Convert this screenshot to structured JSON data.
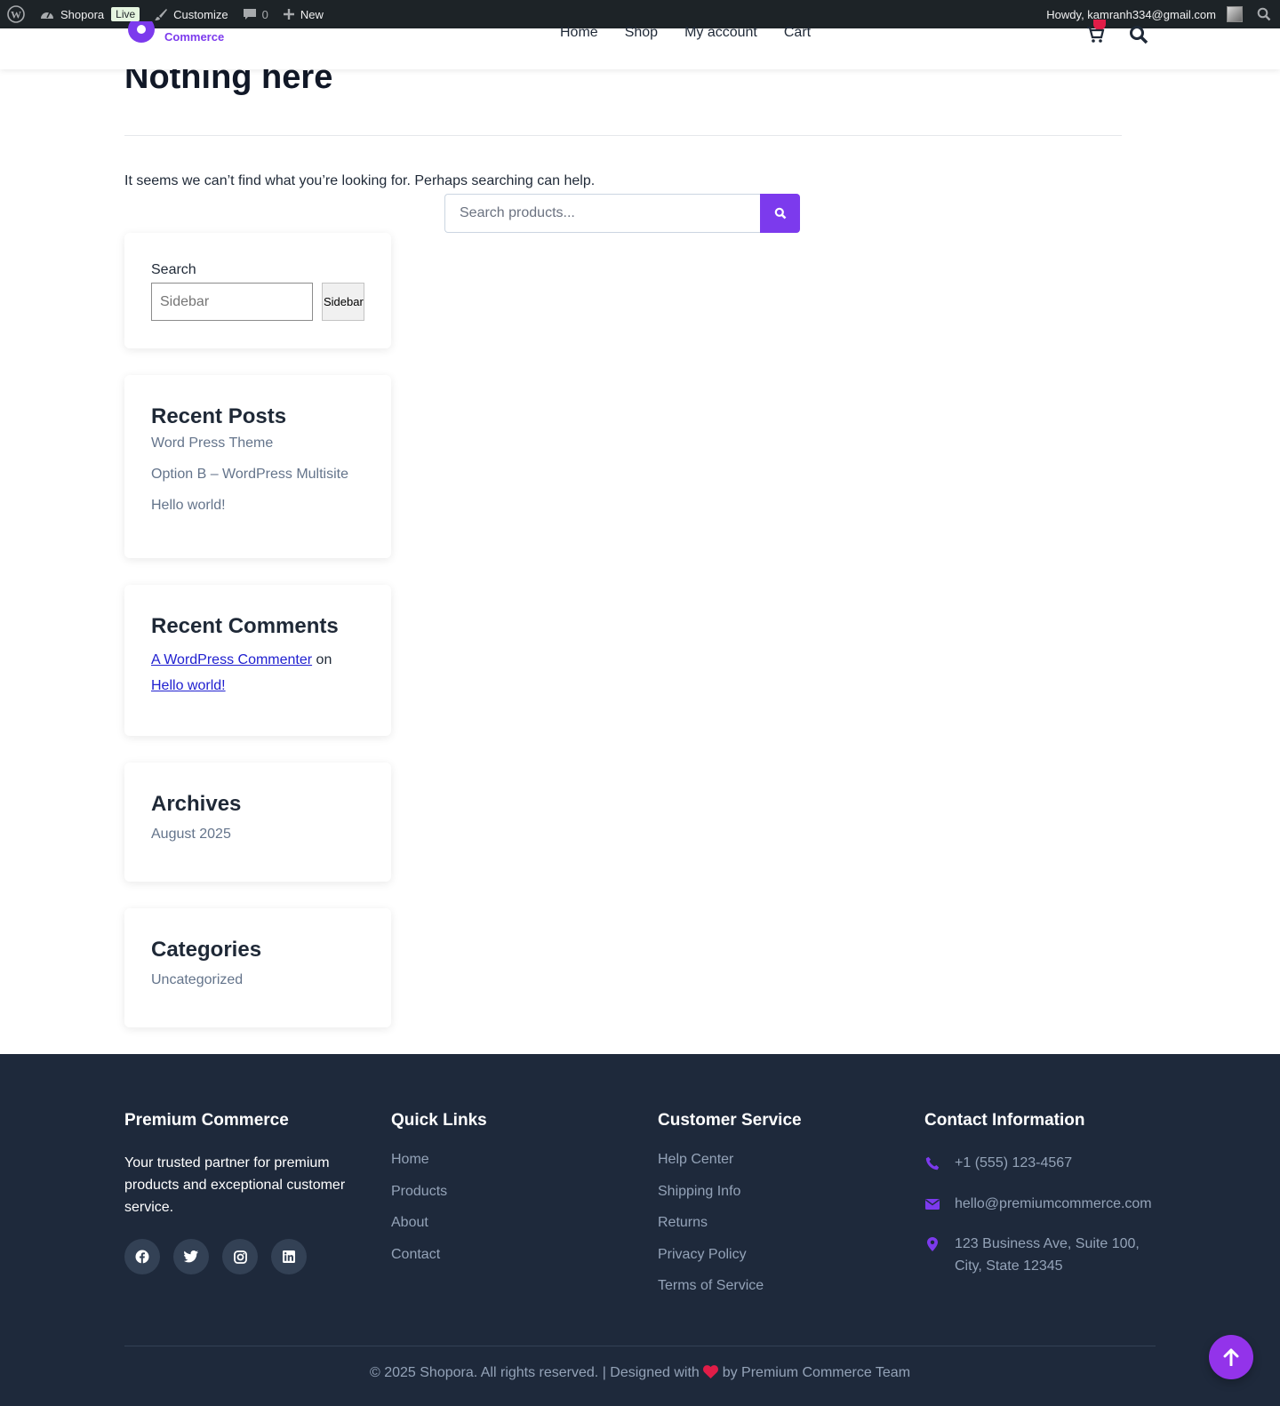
{
  "admin_bar": {
    "site_name": "Shopora",
    "live_badge": "Live",
    "customize": "Customize",
    "comments_count": "0",
    "new_label": "New",
    "howdy": "Howdy, kamranh334@gmail.com"
  },
  "header": {
    "logo_text": "Commerce",
    "nav": [
      "Home",
      "Shop",
      "My account",
      "Cart"
    ]
  },
  "content": {
    "title": "Nothing here",
    "message": "It seems we can’t find what you’re looking for. Perhaps searching can help.",
    "search_placeholder": "Search products..."
  },
  "sidebar": {
    "search": {
      "label": "Search",
      "placeholder": "Sidebar",
      "button": "Sidebar"
    },
    "recent_posts": {
      "title": "Recent Posts",
      "items": [
        "Word Press Theme",
        "Option B – WordPress Multisite",
        "Hello world!"
      ]
    },
    "recent_comments": {
      "title": "Recent Comments",
      "author": "A WordPress Commenter",
      "connector": "on",
      "post": "Hello world!"
    },
    "archives": {
      "title": "Archives",
      "items": [
        "August 2025"
      ]
    },
    "categories": {
      "title": "Categories",
      "items": [
        "Uncategorized"
      ]
    }
  },
  "footer": {
    "about": {
      "title": "Premium Commerce",
      "text": "Your trusted partner for premium products and exceptional customer service."
    },
    "quick_links": {
      "title": "Quick Links",
      "items": [
        "Home",
        "Products",
        "About",
        "Contact"
      ]
    },
    "customer_service": {
      "title": "Customer Service",
      "items": [
        "Help Center",
        "Shipping Info",
        "Returns",
        "Privacy Policy",
        "Terms of Service"
      ]
    },
    "contact": {
      "title": "Contact Information",
      "phone": "+1 (555) 123-4567",
      "email": "hello@premiumcommerce.com",
      "address_line1": "123 Business Ave, Suite 100,",
      "address_line2": "City, State 12345"
    },
    "copyright_left": "© 2025 Shopora. All rights reserved. | Designed with",
    "copyright_right": "by Premium Commerce Team"
  },
  "colors": {
    "accent": "#7c3aed",
    "footer_bg": "#1e293b",
    "admin_bar_bg": "#1d2327",
    "heart": "#e11d48"
  },
  "icons": [
    "wordpress-icon",
    "dashboard-icon",
    "brush-icon",
    "comment-icon",
    "plus-icon",
    "avatar",
    "admin-search-icon",
    "cart-icon",
    "search-icon",
    "facebook-icon",
    "twitter-icon",
    "instagram-icon",
    "linkedin-icon",
    "phone-icon",
    "envelope-icon",
    "map-pin-icon",
    "heart-icon",
    "arrow-up-icon"
  ]
}
